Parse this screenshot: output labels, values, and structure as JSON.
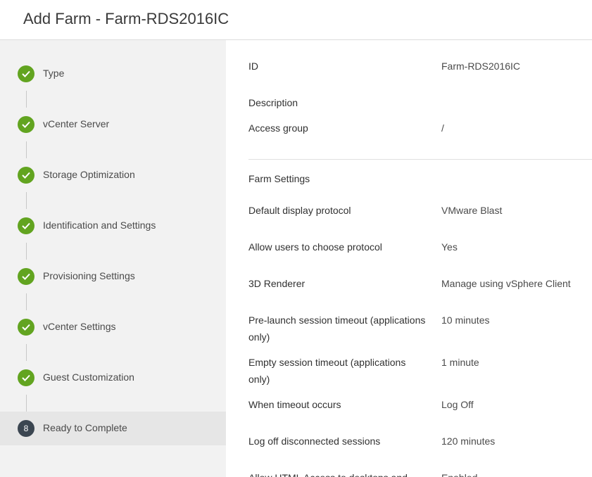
{
  "dialog": {
    "title": "Add Farm - Farm-RDS2016IC"
  },
  "steps": [
    {
      "label": "Type",
      "status": "complete"
    },
    {
      "label": "vCenter Server",
      "status": "complete"
    },
    {
      "label": "Storage Optimization",
      "status": "complete"
    },
    {
      "label": "Identification and Settings",
      "status": "complete"
    },
    {
      "label": "Provisioning Settings",
      "status": "complete"
    },
    {
      "label": "vCenter Settings",
      "status": "complete"
    },
    {
      "label": "Guest Customization",
      "status": "complete"
    },
    {
      "label": "Ready to Complete",
      "status": "current",
      "number": "8"
    }
  ],
  "summary": {
    "id": {
      "label": "ID",
      "value": "Farm-RDS2016IC"
    },
    "description": {
      "label": "Description",
      "value": ""
    },
    "access_group": {
      "label": "Access group",
      "value": "/"
    },
    "farm_settings_title": "Farm Settings",
    "default_display_protocol": {
      "label": "Default display protocol",
      "value": "VMware Blast"
    },
    "allow_users_choose": {
      "label": "Allow users to choose protocol",
      "value": "Yes"
    },
    "renderer_3d": {
      "label": "3D Renderer",
      "value": "Manage using vSphere Client"
    },
    "prelaunch_timeout": {
      "label": "Pre-launch session timeout (applications only)",
      "value": "10 minutes"
    },
    "empty_timeout": {
      "label": "Empty session timeout (applications only)",
      "value": "1 minute"
    },
    "when_timeout": {
      "label": "When timeout occurs",
      "value": "Log Off"
    },
    "log_off_disconnected": {
      "label": "Log off disconnected sessions",
      "value": "120 minutes"
    },
    "allow_html_access": {
      "label": "Allow HTML Access to desktops and",
      "value": "Enabled"
    }
  },
  "colors": {
    "complete": "#62a420",
    "current": "#3b4651",
    "sidebar_bg": "#f2f2f2"
  },
  "icons": {
    "complete": "check-icon"
  }
}
